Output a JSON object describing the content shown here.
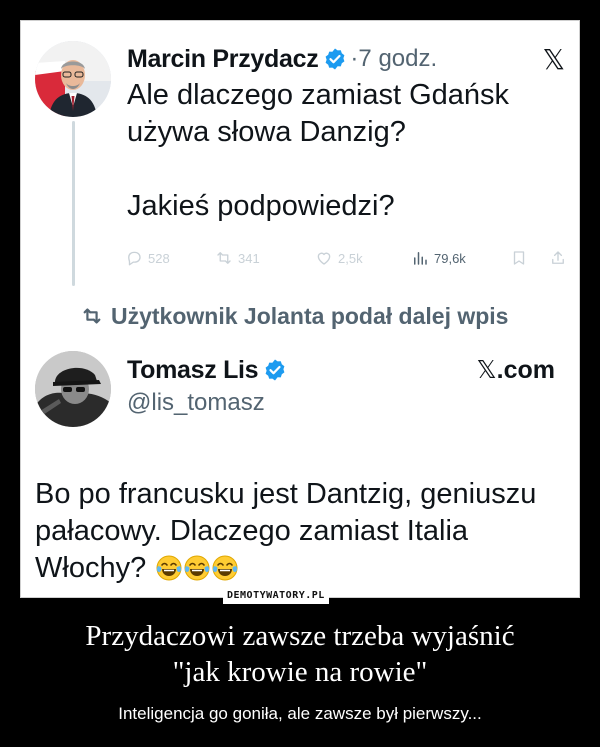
{
  "tweet1": {
    "author_name": "Marcin Przydacz",
    "time": "7 godz.",
    "x_logo": "𝕏",
    "text_lines": [
      "Ale dlaczego zamiast Gdańsk",
      "używa słowa Danzig?",
      "",
      "Jakieś podpowiedzi?"
    ],
    "stats": {
      "replies": "528",
      "reposts": "341",
      "likes": "2,5k",
      "views": "79,6k"
    },
    "icons": [
      "verified-badge-icon",
      "x-logo-icon",
      "reply-icon",
      "repost-icon",
      "like-icon",
      "views-icon",
      "bookmark-icon",
      "share-icon"
    ]
  },
  "repost_banner": "Użytkownik Jolanta podał dalej wpis",
  "tweet2": {
    "author_name": "Tomasz Lis",
    "handle": "@lis_tomasz",
    "source_x": "𝕏",
    "source_suffix": ".com",
    "text_lines": [
      "Bo po francusku jest Dantzig, geniuszu",
      "pałacowy. Dlaczego zamiast Italia",
      "Włochy?"
    ],
    "emoji": [
      "face-with-tears-of-joy",
      "face-with-tears-of-joy",
      "face-with-tears-of-joy"
    ]
  },
  "watermark": "DEMOTYWATORY.PL",
  "caption": {
    "title_lines": [
      "Przydaczowi zawsze trzeba wyjaśnić",
      "\"jak krowie na rowie\""
    ],
    "subtitle": "Inteligencja go goniła, ale zawsze był pierwszy..."
  },
  "colors": {
    "background": "#000000",
    "card": "#ffffff",
    "verified": "#1d9bf0",
    "muted": "#536471",
    "text": "#0f1419"
  }
}
